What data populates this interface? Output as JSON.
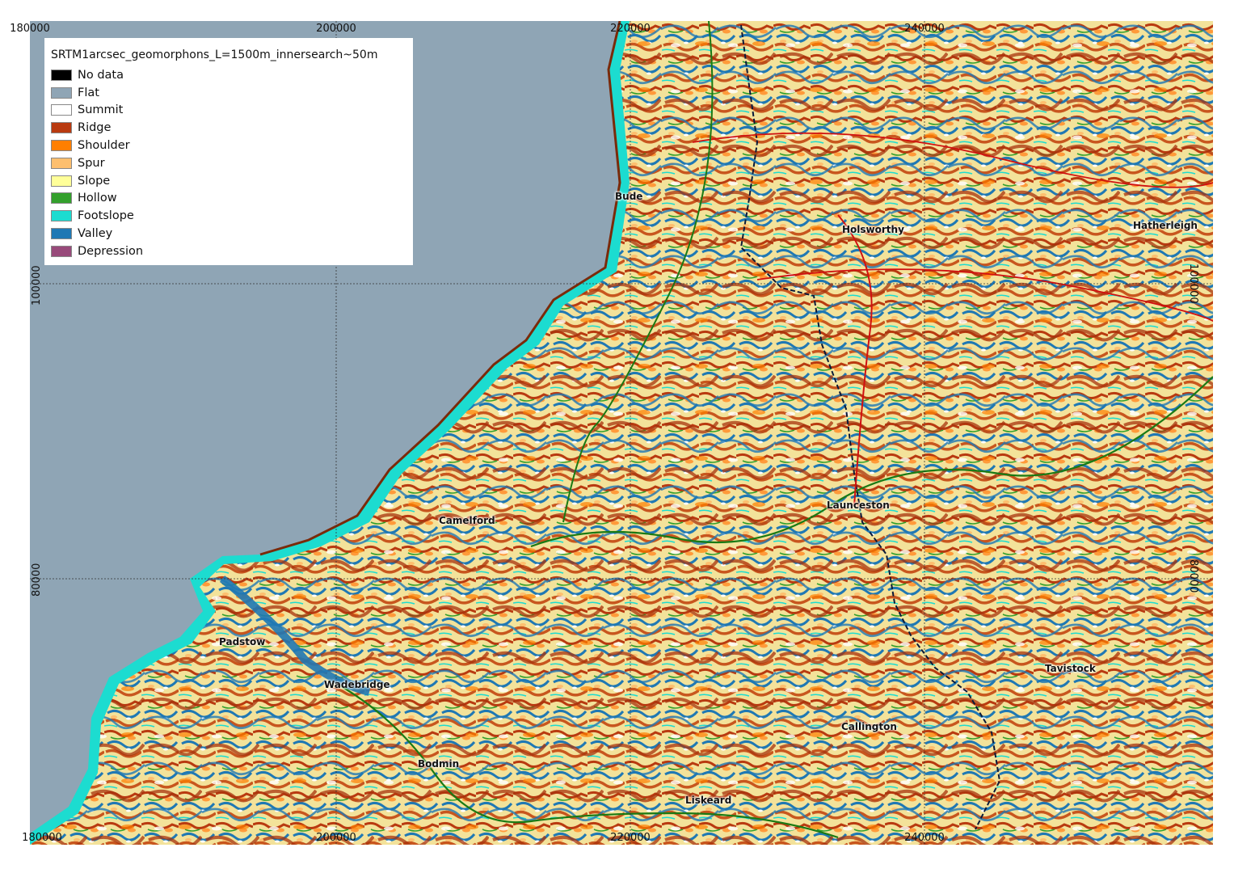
{
  "legend": {
    "title": "SRTM1arcsec_geomorphons_L=1500m_innersearch~50m",
    "items": [
      {
        "label": "No data",
        "color": "#000000"
      },
      {
        "label": "Flat",
        "color": "#8fa5b5"
      },
      {
        "label": "Summit",
        "color": "#ffffff"
      },
      {
        "label": "Ridge",
        "color": "#b93a10"
      },
      {
        "label": "Shoulder",
        "color": "#ff7f00"
      },
      {
        "label": "Spur",
        "color": "#fdbf6f"
      },
      {
        "label": "Slope",
        "color": "#ffff99"
      },
      {
        "label": "Hollow",
        "color": "#33a02c"
      },
      {
        "label": "Footslope",
        "color": "#1cdcd0"
      },
      {
        "label": "Valley",
        "color": "#1f78b4"
      },
      {
        "label": "Depression",
        "color": "#984a7a"
      }
    ]
  },
  "axes": {
    "x_ticks": [
      "180000",
      "200000",
      "220000",
      "240000"
    ],
    "y_ticks": [
      "100000",
      "80000"
    ]
  },
  "towns": [
    {
      "name": "Bude"
    },
    {
      "name": "Holsworthy"
    },
    {
      "name": "Hatherleigh"
    },
    {
      "name": "Launceston"
    },
    {
      "name": "Camelford"
    },
    {
      "name": "Padstow"
    },
    {
      "name": "Wadebridge"
    },
    {
      "name": "Tavistock"
    },
    {
      "name": "Callington"
    },
    {
      "name": "Bodmin"
    },
    {
      "name": "Liskeard"
    }
  ]
}
